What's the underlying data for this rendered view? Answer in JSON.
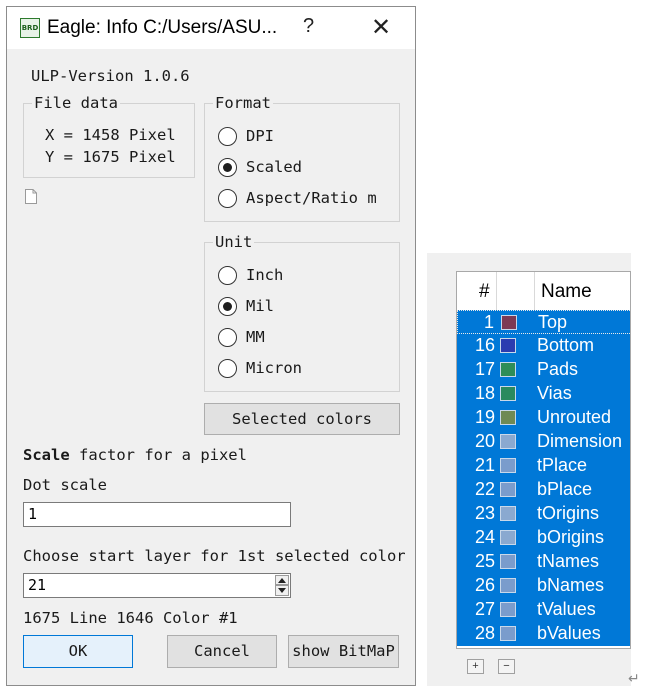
{
  "dialog": {
    "title": "Eagle: Info C:/Users/ASU...",
    "icon_text": "BRD",
    "help_label": "?",
    "close_label": "✕",
    "ulp_version": "ULP-Version 1.0.6",
    "file_data": {
      "label": "File data",
      "x_line": "X =  1458 Pixel",
      "y_line": "Y =  1675 Pixel"
    },
    "format": {
      "label": "Format",
      "options": [
        "DPI",
        "Scaled",
        "Aspect/Ratio m"
      ],
      "selected": "Scaled"
    },
    "unit": {
      "label": "Unit",
      "options": [
        "Inch",
        "Mil",
        "MM",
        "Micron"
      ],
      "selected": "Mil"
    },
    "selected_colors_label": "Selected colors",
    "scale_bold": "Scale",
    "scale_rest": " factor for a pixel",
    "dot_scale_label": "Dot scale",
    "dot_scale_value": "1",
    "start_layer_label": "Choose start layer for 1st selected color",
    "start_layer_value": "21",
    "status_line": "1675 Line 1646 Color #1",
    "ok_label": "OK",
    "cancel_label": "Cancel",
    "bitmap_label": "show BitMaP"
  },
  "layer_table": {
    "headers": {
      "number": "#",
      "name": "Name"
    },
    "rows": [
      {
        "num": "1",
        "name": "Top",
        "color": "#7d3a55"
      },
      {
        "num": "16",
        "name": "Bottom",
        "color": "#2b3cb0"
      },
      {
        "num": "17",
        "name": "Pads",
        "color": "#2f8d58"
      },
      {
        "num": "18",
        "name": "Vias",
        "color": "#2a8a5e"
      },
      {
        "num": "19",
        "name": "Unrouted",
        "color": "#6f8a55"
      },
      {
        "num": "20",
        "name": "Dimension",
        "color": "#8aa9d0"
      },
      {
        "num": "21",
        "name": "tPlace",
        "color": "#7a9ccc"
      },
      {
        "num": "22",
        "name": "bPlace",
        "color": "#7a9ccc"
      },
      {
        "num": "23",
        "name": "tOrigins",
        "color": "#8aa9d0"
      },
      {
        "num": "24",
        "name": "bOrigins",
        "color": "#8aa9d0"
      },
      {
        "num": "25",
        "name": "tNames",
        "color": "#7a9ccc"
      },
      {
        "num": "26",
        "name": "bNames",
        "color": "#7a9ccc"
      },
      {
        "num": "27",
        "name": "tValues",
        "color": "#7a9ccc"
      },
      {
        "num": "28",
        "name": "bValues",
        "color": "#7a9ccc"
      }
    ],
    "add_label": "+",
    "remove_label": "−"
  },
  "return_glyph": "↵"
}
